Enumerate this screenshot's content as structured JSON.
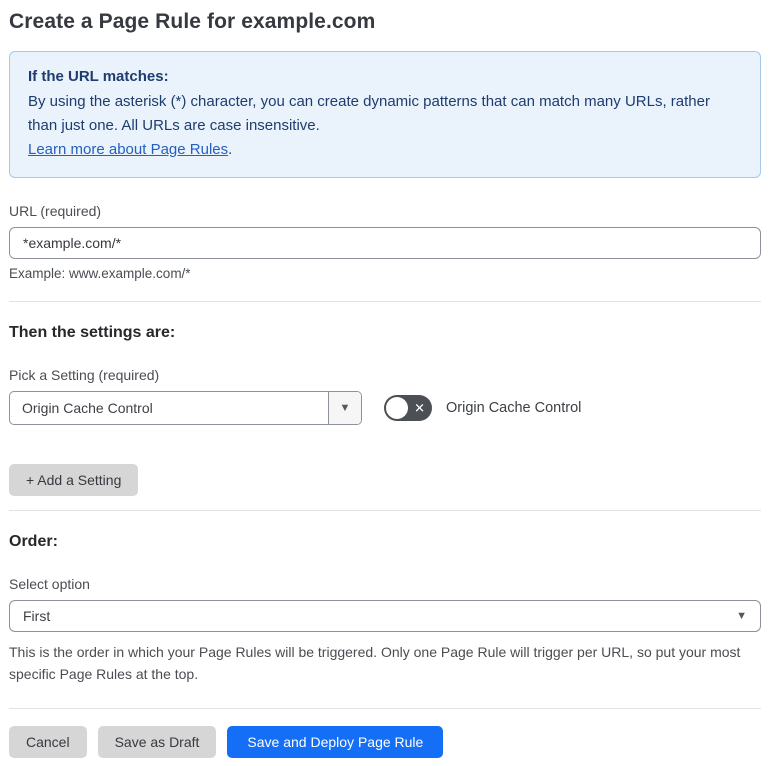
{
  "page": {
    "title": "Create a Page Rule for example.com"
  },
  "info_box": {
    "heading": "If the URL matches:",
    "body": "By using the asterisk (*) character, you can create dynamic patterns that can match many URLs, rather than just one. All URLs are case insensitive.",
    "link_label": "Learn more about Page Rules",
    "link_suffix": "."
  },
  "url_section": {
    "label": "URL (required)",
    "input_value": "*example.com/*",
    "helper": "Example: www.example.com/*"
  },
  "settings_section": {
    "heading": "Then the settings are:",
    "picker_label": "Pick a Setting (required)",
    "selected_setting": "Origin Cache Control",
    "caret_glyph": "▼",
    "toggle_state": "off",
    "toggle_x_glyph": "✕",
    "toggle_label": "Origin Cache Control",
    "add_setting_label": "+ Add a Setting"
  },
  "order_section": {
    "heading": "Order:",
    "select_label": "Select option",
    "selected_option": "First",
    "caret_glyph": "▼",
    "helper": "This is the order in which your Page Rules will be triggered. Only one Page Rule will trigger per URL, so put your most specific Page Rules at the top."
  },
  "footer": {
    "cancel_label": "Cancel",
    "save_draft_label": "Save as Draft",
    "save_deploy_label": "Save and Deploy Page Rule"
  },
  "colors": {
    "accent_blue": "#146ef6",
    "info_bg": "#eaf3fc",
    "info_border": "#a6c9ea",
    "info_text": "#1e3c6e",
    "link_blue": "#2460bf",
    "toggle_off": "#4c4f54",
    "button_gray": "#d6d6d6"
  }
}
